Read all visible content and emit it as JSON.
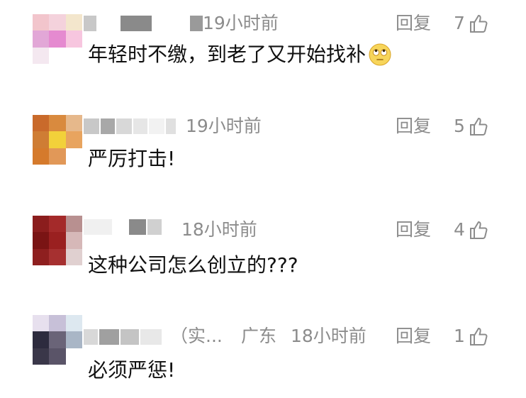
{
  "comments": [
    {
      "time": "19小时前",
      "reply_label": "回复",
      "likes": "7",
      "text": "年轻时不缴，到老了又开始找补",
      "emoji": "rolling-eyes-emoji",
      "avatar_colors": [
        "#f2c5cc",
        "#f4d2dc",
        "#f3e6cc",
        "#e2a7d7",
        "#e58ad0",
        "#f7c6df",
        "#f4e8f0",
        "#ffffff",
        "#ffffff"
      ]
    },
    {
      "time": "19小时前",
      "reply_label": "回复",
      "likes": "5",
      "text": "严厉打击!",
      "avatar_colors": [
        "#c96a2b",
        "#d98a3e",
        "#e6b88b",
        "#cf7d34",
        "#f2d13a",
        "#e8a45f",
        "#d57a2c",
        "#e19858",
        "#ffffff"
      ]
    },
    {
      "time": "18小时前",
      "reply_label": "回复",
      "likes": "4",
      "text": "这种公司怎么创立的???",
      "avatar_colors": [
        "#8b1d1d",
        "#a42a2a",
        "#b89090",
        "#7a1414",
        "#9a2020",
        "#d6b8b8",
        "#8e1f1f",
        "#a63030",
        "#e0d0d0"
      ]
    },
    {
      "suffix": "（实...",
      "region": "广东",
      "time": "18小时前",
      "reply_label": "回复",
      "likes": "1",
      "text": "必须严惩!",
      "avatar_colors": [
        "#e7e0ee",
        "#c7c0d8",
        "#dde8f0",
        "#2d2b3e",
        "#6a6478",
        "#a9b6c6",
        "#3a3749",
        "#5a5468",
        "#ffffff"
      ]
    }
  ],
  "colors": {
    "meta": "#8c8c8c",
    "text": "#111111"
  }
}
